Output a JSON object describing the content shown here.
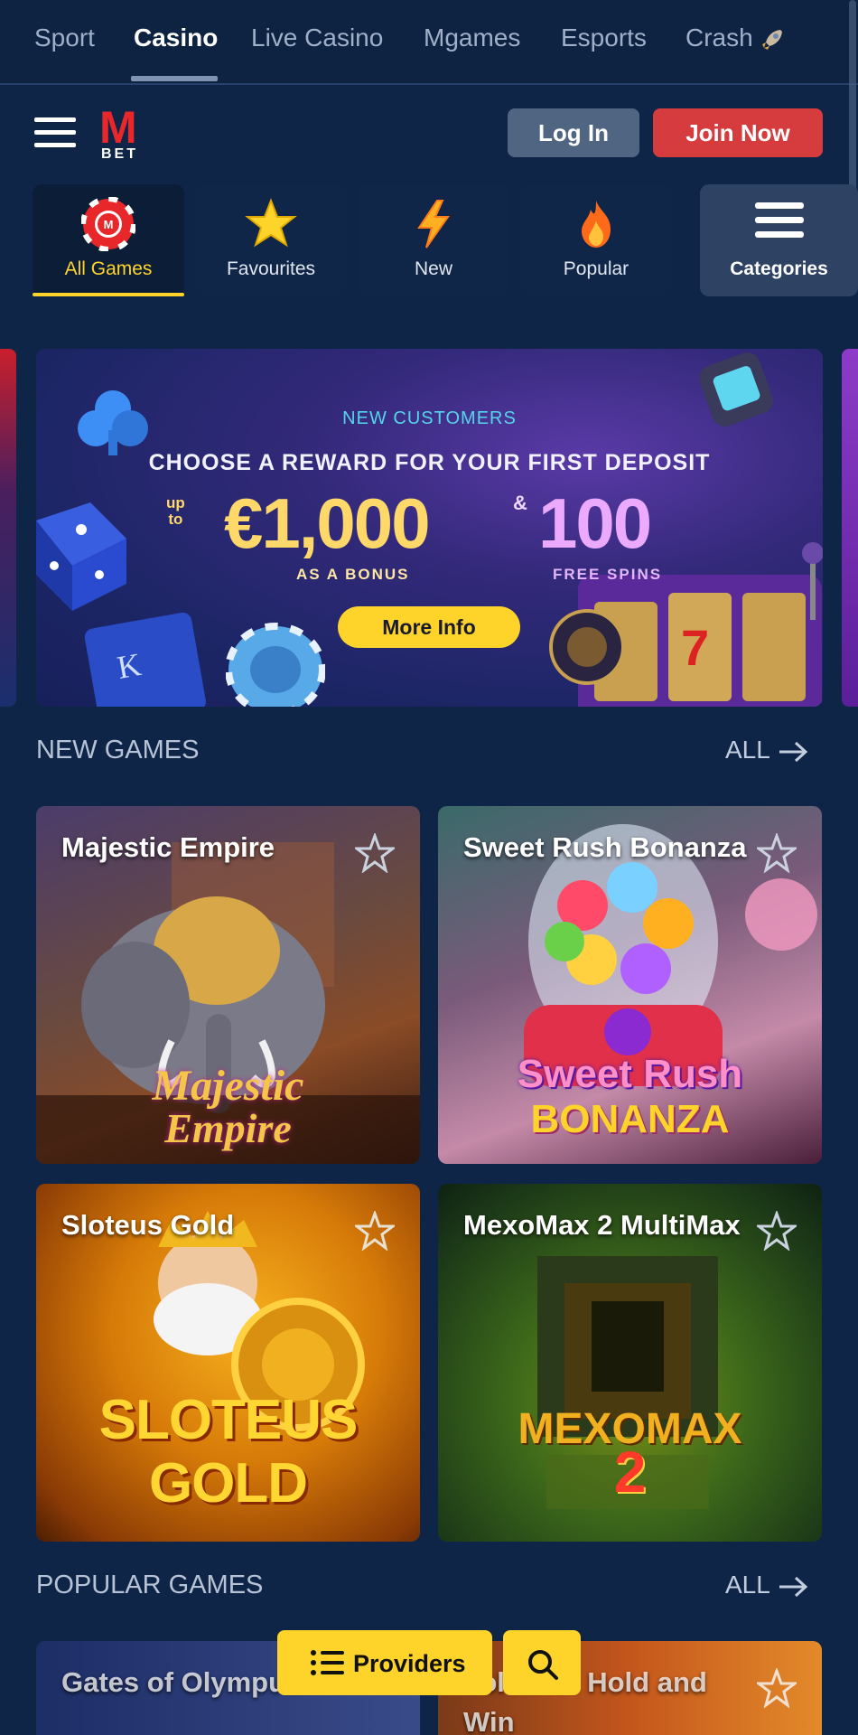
{
  "top_nav": {
    "tabs": [
      "Sport",
      "Casino",
      "Live Casino",
      "Mgames",
      "Esports",
      "Crash"
    ],
    "active": "Casino"
  },
  "header": {
    "logo_letter": "M",
    "logo_sub": "BET",
    "login_label": "Log In",
    "join_label": "Join Now"
  },
  "categories": [
    {
      "label": "All Games",
      "icon": "chip-icon"
    },
    {
      "label": "Favourites",
      "icon": "star-icon"
    },
    {
      "label": "New",
      "icon": "lightning-icon"
    },
    {
      "label": "Popular",
      "icon": "flame-icon"
    },
    {
      "label": "Categories",
      "icon": "menu-icon"
    }
  ],
  "banner": {
    "eyebrow": "NEW CUSTOMERS",
    "headline": "CHOOSE A REWARD FOR YOUR FIRST DEPOSIT",
    "upto_1": "up",
    "upto_2": "to",
    "amount": "€1,000",
    "amount_sub": "AS A BONUS",
    "amp": "&",
    "spins": "100",
    "spins_sub": "FREE SPINS",
    "cta": "More Info"
  },
  "sections": {
    "new_games": {
      "title": "NEW GAMES",
      "all": "ALL",
      "games": [
        {
          "name": "Majestic Empire",
          "logo_line1": "Majestic",
          "logo_line2": "Empire"
        },
        {
          "name": "Sweet Rush Bonanza",
          "logo_line1": "Sweet Rush",
          "logo_line2": "BONANZA"
        },
        {
          "name": "Sloteus Gold",
          "logo_line1": "SLOTEUS",
          "logo_line2": "GOLD"
        },
        {
          "name": "MexoMax 2 MultiMax",
          "logo_line1": "MEXOMAX",
          "logo_line2": "2"
        }
      ]
    },
    "popular_games": {
      "title": "POPULAR GAMES",
      "all": "ALL",
      "games": [
        {
          "name": "Gates of Olympus™"
        },
        {
          "name": "Volcano: Hold and Win"
        }
      ]
    }
  },
  "floating": {
    "providers_label": "Providers"
  },
  "colors": {
    "background": "#0f2548",
    "accent_yellow": "#ffd42a",
    "join_red": "#d63c3e",
    "login_slate": "#4f6582"
  }
}
